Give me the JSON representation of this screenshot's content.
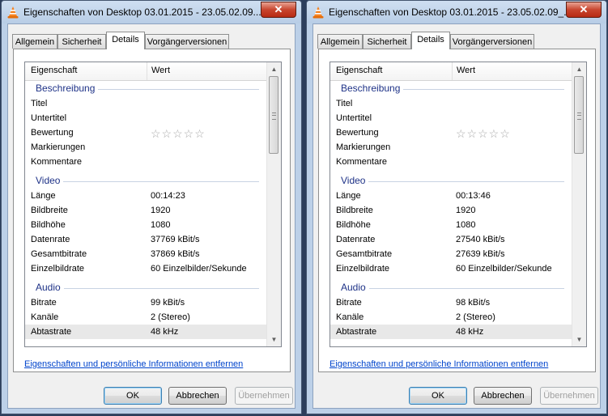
{
  "windows": [
    {
      "title": "Eigenschaften von Desktop 03.01.2015 - 23.05.02.09...",
      "close_label": "✕",
      "tabs": [
        "Allgemein",
        "Sicherheit",
        "Details",
        "Vorgängerversionen"
      ],
      "active_tab": "Details",
      "columns": {
        "property": "Eigenschaft",
        "value": "Wert"
      },
      "groups": {
        "description": "Beschreibung",
        "video": "Video",
        "audio": "Audio"
      },
      "rows": {
        "title": {
          "name": "Titel",
          "value": ""
        },
        "subtitle": {
          "name": "Untertitel",
          "value": ""
        },
        "rating": {
          "name": "Bewertung",
          "value": "☆☆☆☆☆"
        },
        "tags": {
          "name": "Markierungen",
          "value": ""
        },
        "comments": {
          "name": "Kommentare",
          "value": ""
        },
        "length": {
          "name": "Länge",
          "value": "00:14:23"
        },
        "width": {
          "name": "Bildbreite",
          "value": "1920"
        },
        "height": {
          "name": "Bildhöhe",
          "value": "1080"
        },
        "datarate": {
          "name": "Datenrate",
          "value": "37769 kBit/s"
        },
        "totalbitrate": {
          "name": "Gesamtbitrate",
          "value": "37869 kBit/s"
        },
        "framerate": {
          "name": "Einzelbildrate",
          "value": "60 Einzelbilder/Sekunde"
        },
        "bitrate": {
          "name": "Bitrate",
          "value": "99 kBit/s"
        },
        "channels": {
          "name": "Kanäle",
          "value": "2 (Stereo)"
        },
        "samplerate": {
          "name": "Abtastrate",
          "value": "48 kHz"
        }
      },
      "link": "Eigenschaften und persönliche Informationen entfernen",
      "buttons": {
        "ok": "OK",
        "cancel": "Abbrechen",
        "apply": "Übernehmen"
      }
    },
    {
      "title": "Eigenschaften von Desktop 03.01.2015 - 23.05.02.09_...",
      "close_label": "✕",
      "tabs": [
        "Allgemein",
        "Sicherheit",
        "Details",
        "Vorgängerversionen"
      ],
      "active_tab": "Details",
      "columns": {
        "property": "Eigenschaft",
        "value": "Wert"
      },
      "groups": {
        "description": "Beschreibung",
        "video": "Video",
        "audio": "Audio"
      },
      "rows": {
        "title": {
          "name": "Titel",
          "value": ""
        },
        "subtitle": {
          "name": "Untertitel",
          "value": ""
        },
        "rating": {
          "name": "Bewertung",
          "value": "☆☆☆☆☆"
        },
        "tags": {
          "name": "Markierungen",
          "value": ""
        },
        "comments": {
          "name": "Kommentare",
          "value": ""
        },
        "length": {
          "name": "Länge",
          "value": "00:13:46"
        },
        "width": {
          "name": "Bildbreite",
          "value": "1920"
        },
        "height": {
          "name": "Bildhöhe",
          "value": "1080"
        },
        "datarate": {
          "name": "Datenrate",
          "value": "27540 kBit/s"
        },
        "totalbitrate": {
          "name": "Gesamtbitrate",
          "value": "27639 kBit/s"
        },
        "framerate": {
          "name": "Einzelbildrate",
          "value": "60 Einzelbilder/Sekunde"
        },
        "bitrate": {
          "name": "Bitrate",
          "value": "98 kBit/s"
        },
        "channels": {
          "name": "Kanäle",
          "value": "2 (Stereo)"
        },
        "samplerate": {
          "name": "Abtastrate",
          "value": "48 kHz"
        }
      },
      "link": "Eigenschaften und persönliche Informationen entfernen",
      "buttons": {
        "ok": "OK",
        "cancel": "Abbrechen",
        "apply": "Übernehmen"
      }
    }
  ],
  "icons": {
    "app": "vlc-cone-icon",
    "close": "close-icon",
    "rating": "star-icon",
    "scroll_up": "chevron-up-icon",
    "scroll_down": "chevron-down-icon"
  },
  "colors": {
    "titlebar": "#bcd0e8",
    "group_heading": "#1e3287",
    "link": "#0044cc",
    "close": "#c8452e"
  }
}
